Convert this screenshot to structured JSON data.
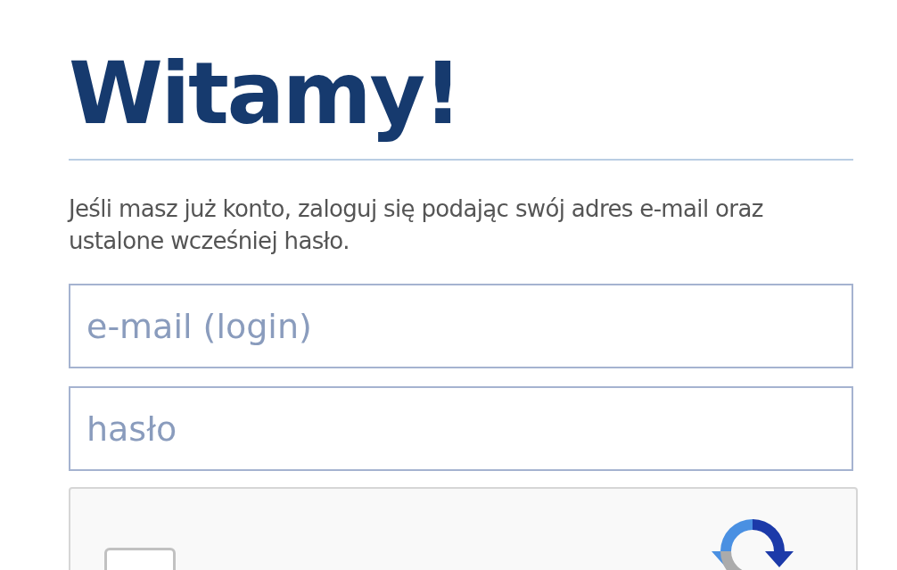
{
  "heading": "Witamy!",
  "intro": "Jeśli masz już konto, zaloguj się podając swój adres e-mail oraz ustalone wcześniej hasło.",
  "fields": [
    {
      "placeholder": "e-mail (login)"
    },
    {
      "placeholder": "hasło"
    }
  ],
  "captcha": {
    "checked": false
  }
}
